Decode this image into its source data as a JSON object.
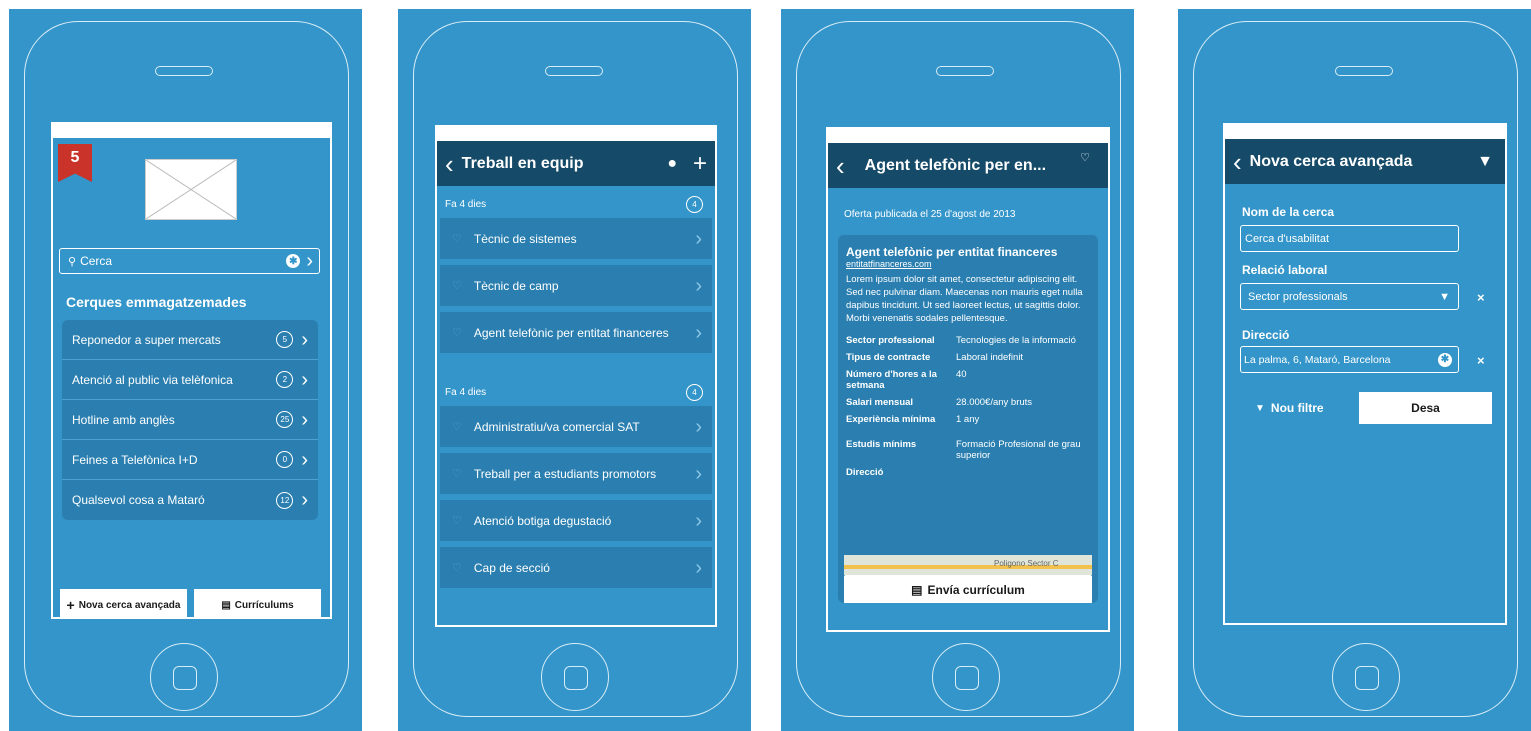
{
  "screen1": {
    "badge": "5",
    "search_placeholder": "Cerca",
    "section_title": "Cerques emmagatzemades",
    "saved": [
      {
        "label": "Reponedor a super mercats",
        "count": "5"
      },
      {
        "label": "Atenció al public via telèfonica",
        "count": "2"
      },
      {
        "label": "Hotline amb anglès",
        "count": "25"
      },
      {
        "label": "Feines a Telefònica I+D",
        "count": "0"
      },
      {
        "label": "Qualsevol cosa a Mataró",
        "count": "12"
      }
    ],
    "new_search": "Nova cerca avançada",
    "resumes": "Currículums"
  },
  "screen2": {
    "title": "Treball en equip",
    "groups": [
      {
        "label": "Fa 4 dies",
        "count": "4",
        "jobs": [
          "Tècnic de sistemes",
          "Tècnic de camp",
          "Agent telefònic per entitat financeres"
        ]
      },
      {
        "label": "Fa 4 dies",
        "count": "4",
        "jobs": [
          "Administratiu/va comercial SAT",
          "Treball per a estudiants promotors",
          "Atenció botiga degustació",
          "Cap de secció"
        ]
      }
    ]
  },
  "screen3": {
    "title": "Agent telefònic per en...",
    "published": "Oferta publicada el 25 d'agost de 2013",
    "job_title": "Agent telefònic per entitat financeres",
    "company_link": "entitatfinanceres.com",
    "description": "Lorem ipsum dolor sit amet, consectetur adipiscing elit. Sed nec pulvinar diam. Maecenas non mauris eget nulla dapibus tincidunt. Ut sed laoreet lectus, ut sagittis dolor. Morbi venenatis sodales pellentesque.",
    "details": [
      {
        "k": "Sector professional",
        "v": "Tecnologies de la informació"
      },
      {
        "k": "Tipus de contracte",
        "v": "Laboral indefinit"
      },
      {
        "k": "Número d'hores a la setmana",
        "v": "40"
      },
      {
        "k": "Salari mensual",
        "v": "28.000€/any bruts"
      },
      {
        "k": "Experiència mínima",
        "v": "1 any"
      },
      {
        "k": "Estudis mínims",
        "v": "Formació Profesional de grau superior"
      }
    ],
    "address_label": "Direcció",
    "map_text": "Poligono Sector C",
    "send_button": "Envía currículum"
  },
  "screen4": {
    "title": "Nova cerca avançada",
    "name_label": "Nom de la cerca",
    "name_value": "Cerca d'usabilitat",
    "relation_label": "Relació laboral",
    "relation_value": "Sector professionals",
    "address_label": "Direcció",
    "address_value": "La palma, 6, Mataró, Barcelona",
    "new_filter": "Nou filtre",
    "save": "Desa"
  },
  "colors": {
    "background": "#3395c9",
    "navbar": "#154a68",
    "row": "#2a7fb0",
    "badge": "#c9332a"
  }
}
